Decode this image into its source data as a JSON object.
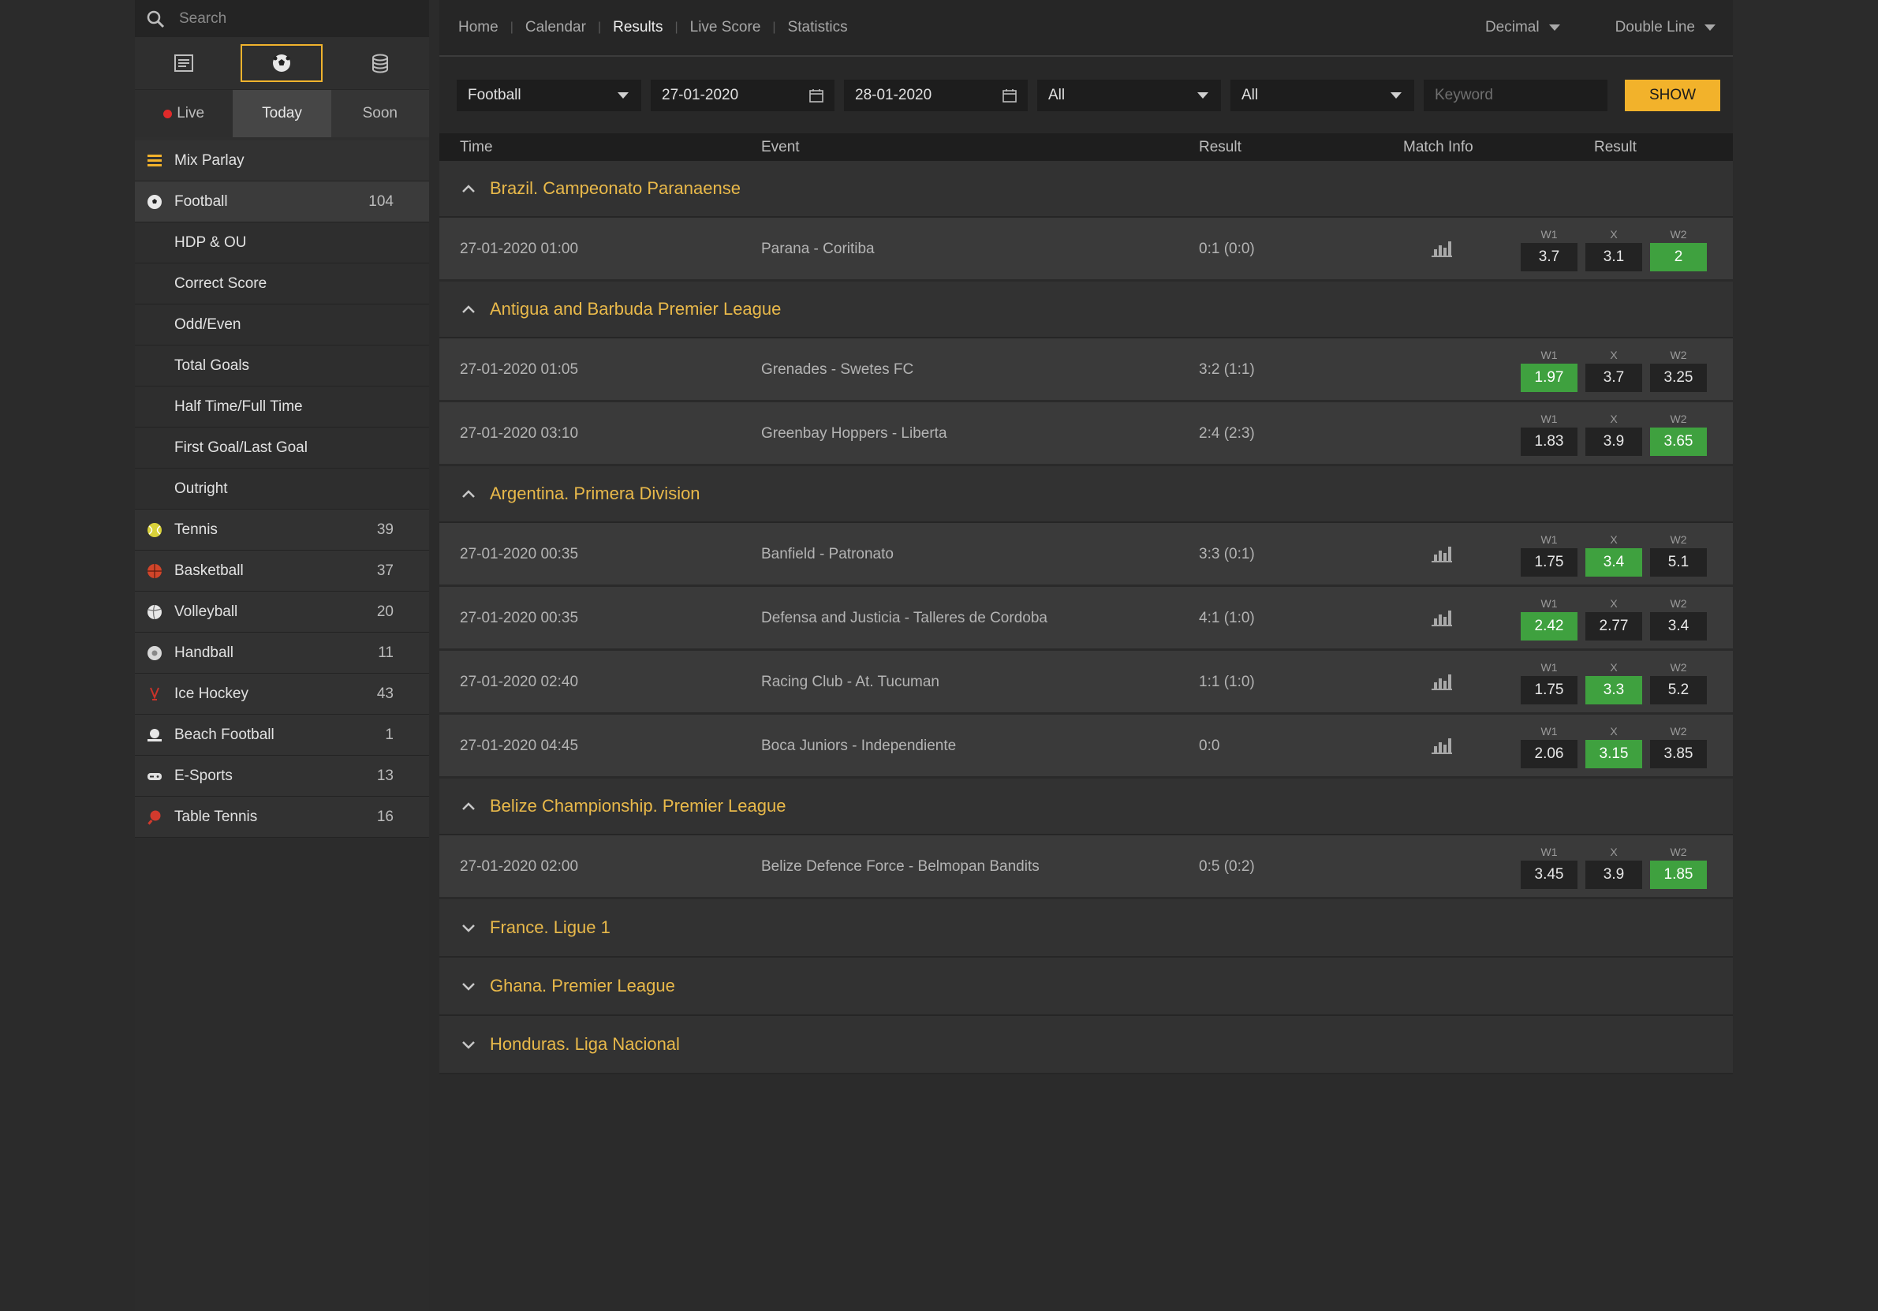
{
  "sidebar": {
    "search_placeholder": "Search",
    "time_tabs": {
      "live": "Live",
      "today": "Today",
      "soon": "Soon"
    },
    "items": [
      {
        "label": "Mix Parlay",
        "count": "",
        "icon": "list-icon",
        "type": "main"
      },
      {
        "label": "Football",
        "count": "104",
        "icon": "football-icon",
        "type": "active"
      },
      {
        "label": "HDP & OU",
        "count": "",
        "icon": "",
        "type": "sub"
      },
      {
        "label": "Correct Score",
        "count": "",
        "icon": "",
        "type": "sub"
      },
      {
        "label": "Odd/Even",
        "count": "",
        "icon": "",
        "type": "sub"
      },
      {
        "label": "Total Goals",
        "count": "",
        "icon": "",
        "type": "sub"
      },
      {
        "label": "Half Time/Full Time",
        "count": "",
        "icon": "",
        "type": "sub"
      },
      {
        "label": "First Goal/Last Goal",
        "count": "",
        "icon": "",
        "type": "sub"
      },
      {
        "label": "Outright",
        "count": "",
        "icon": "",
        "type": "sub"
      },
      {
        "label": "Tennis",
        "count": "39",
        "icon": "tennis-ball-icon",
        "type": "main"
      },
      {
        "label": "Basketball",
        "count": "37",
        "icon": "basketball-icon",
        "type": "main"
      },
      {
        "label": "Volleyball",
        "count": "20",
        "icon": "volleyball-icon",
        "type": "main"
      },
      {
        "label": "Handball",
        "count": "11",
        "icon": "handball-icon",
        "type": "main"
      },
      {
        "label": "Ice Hockey",
        "count": "43",
        "icon": "ice-hockey-icon",
        "type": "main"
      },
      {
        "label": "Beach Football",
        "count": "1",
        "icon": "beach-football-icon",
        "type": "main"
      },
      {
        "label": "E-Sports",
        "count": "13",
        "icon": "gamepad-icon",
        "type": "main"
      },
      {
        "label": "Table Tennis",
        "count": "16",
        "icon": "table-tennis-icon",
        "type": "main"
      }
    ]
  },
  "nav": {
    "home": "Home",
    "calendar": "Calendar",
    "results": "Results",
    "live_score": "Live Score",
    "statistics": "Statistics",
    "odds_format": "Decimal",
    "view_mode": "Double Line"
  },
  "filters": {
    "sport": "Football",
    "date_from": "27-01-2020",
    "date_to": "28-01-2020",
    "filter1": "All",
    "filter2": "All",
    "keyword_placeholder": "Keyword",
    "show_label": "SHOW"
  },
  "table_header": {
    "time": "Time",
    "event": "Event",
    "result": "Result",
    "match_info": "Match Info",
    "result2": "Result"
  },
  "odds_labels": {
    "w1": "W1",
    "x": "X",
    "w2": "W2"
  },
  "leagues": [
    {
      "name": "Brazil. Campeonato Paranaense",
      "expanded": true,
      "matches": [
        {
          "time": "27-01-2020 01:00",
          "event": "Parana - Coritiba",
          "result": "0:1 (0:0)",
          "stats": true,
          "w1": "3.7",
          "x": "3.1",
          "w2": "2",
          "win": "w2"
        }
      ]
    },
    {
      "name": "Antigua and Barbuda Premier League",
      "expanded": true,
      "matches": [
        {
          "time": "27-01-2020 01:05",
          "event": "Grenades - Swetes FC",
          "result": "3:2 (1:1)",
          "stats": false,
          "w1": "1.97",
          "x": "3.7",
          "w2": "3.25",
          "win": "w1"
        },
        {
          "time": "27-01-2020 03:10",
          "event": "Greenbay Hoppers - Liberta",
          "result": "2:4 (2:3)",
          "stats": false,
          "w1": "1.83",
          "x": "3.9",
          "w2": "3.65",
          "win": "w2"
        }
      ]
    },
    {
      "name": "Argentina. Primera Division",
      "expanded": true,
      "matches": [
        {
          "time": "27-01-2020 00:35",
          "event": "Banfield - Patronato",
          "result": "3:3 (0:1)",
          "stats": true,
          "w1": "1.75",
          "x": "3.4",
          "w2": "5.1",
          "win": "x"
        },
        {
          "time": "27-01-2020 00:35",
          "event": "Defensa and Justicia - Talleres de Cordoba",
          "result": "4:1 (1:0)",
          "stats": true,
          "w1": "2.42",
          "x": "2.77",
          "w2": "3.4",
          "win": "w1"
        },
        {
          "time": "27-01-2020 02:40",
          "event": "Racing Club - At. Tucuman",
          "result": "1:1 (1:0)",
          "stats": true,
          "w1": "1.75",
          "x": "3.3",
          "w2": "5.2",
          "win": "x"
        },
        {
          "time": "27-01-2020 04:45",
          "event": "Boca Juniors - Independiente",
          "result": "0:0",
          "stats": true,
          "w1": "2.06",
          "x": "3.15",
          "w2": "3.85",
          "win": "x"
        }
      ]
    },
    {
      "name": "Belize Championship. Premier League",
      "expanded": true,
      "matches": [
        {
          "time": "27-01-2020 02:00",
          "event": "Belize Defence Force - Belmopan Bandits",
          "result": "0:5 (0:2)",
          "stats": false,
          "w1": "3.45",
          "x": "3.9",
          "w2": "1.85",
          "win": "w2"
        }
      ]
    },
    {
      "name": "France. Ligue 1",
      "expanded": false,
      "matches": []
    },
    {
      "name": "Ghana. Premier League",
      "expanded": false,
      "matches": []
    },
    {
      "name": "Honduras. Liga Nacional",
      "expanded": false,
      "matches": []
    }
  ],
  "colors": {
    "accent": "#f2b22b",
    "league": "#e9b94a",
    "win": "#3fa13f",
    "live": "#e02a2a"
  }
}
